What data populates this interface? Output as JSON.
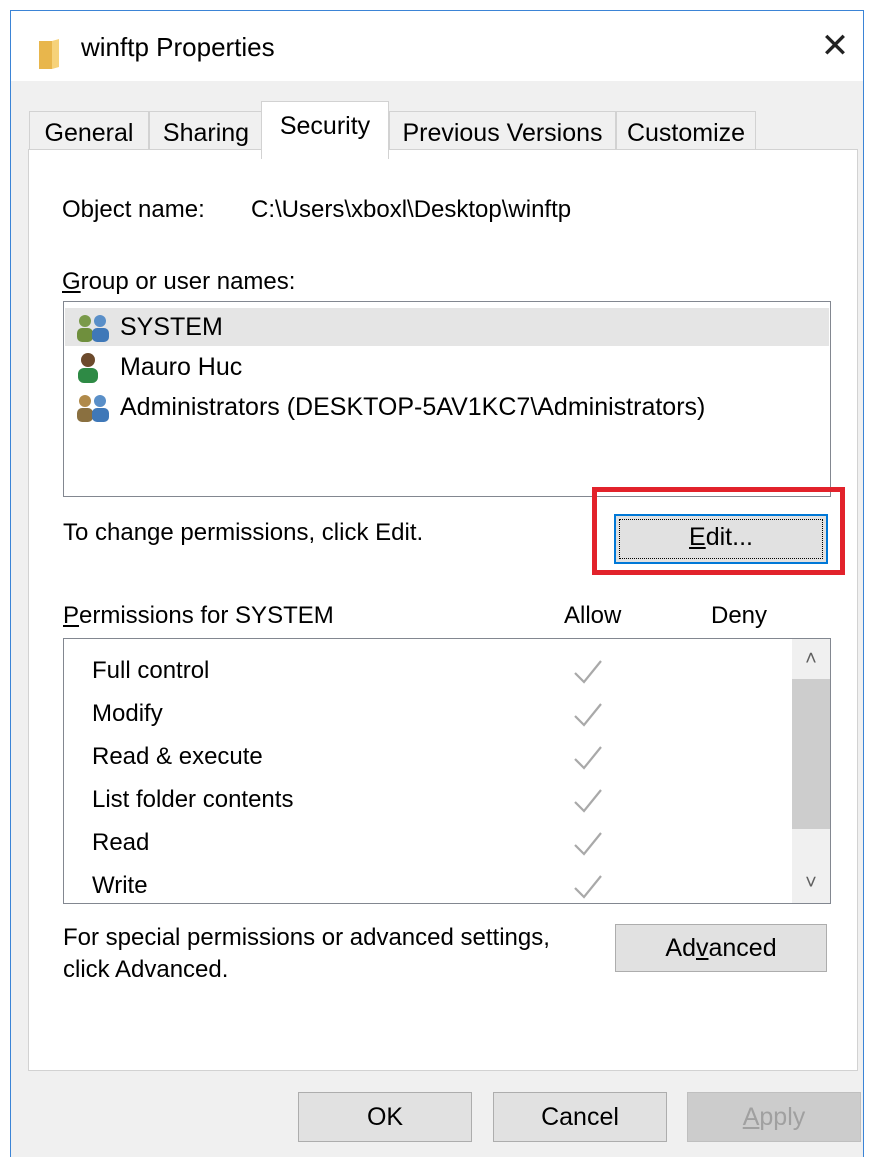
{
  "window": {
    "title": "winftp Properties",
    "close_glyph": "✕"
  },
  "tabs": [
    {
      "label": "General",
      "active": false
    },
    {
      "label": "Sharing",
      "active": false
    },
    {
      "label": "Security",
      "active": true
    },
    {
      "label": "Previous Versions",
      "active": false
    },
    {
      "label": "Customize",
      "active": false
    }
  ],
  "security": {
    "object_name_label": "Object name:",
    "object_name_value": "C:\\Users\\xboxl\\Desktop\\winftp",
    "group_label_accel": "G",
    "group_label_rest": "roup or user names:",
    "users": [
      {
        "name": "SYSTEM",
        "icon": "users-group-icon",
        "selected": true
      },
      {
        "name": "Mauro Huc",
        "icon": "user-icon",
        "selected": false
      },
      {
        "name": "Administrators (DESKTOP-5AV1KC7\\Administrators)",
        "icon": "users-group-icon",
        "selected": false
      }
    ],
    "change_text": "To change permissions, click Edit.",
    "edit_button_accel": "E",
    "edit_button_rest": "dit...",
    "permissions_label_accel": "P",
    "permissions_label_rest": "ermissions for SYSTEM",
    "allow_header": "Allow",
    "deny_header": "Deny",
    "permissions": [
      {
        "name": "Full control",
        "allow": true,
        "deny": false
      },
      {
        "name": "Modify",
        "allow": true,
        "deny": false
      },
      {
        "name": "Read & execute",
        "allow": true,
        "deny": false
      },
      {
        "name": "List folder contents",
        "allow": true,
        "deny": false
      },
      {
        "name": "Read",
        "allow": true,
        "deny": false
      },
      {
        "name": "Write",
        "allow": true,
        "deny": false
      }
    ],
    "advanced_text_line1": "For special permissions or advanced settings,",
    "advanced_text_line2": "click Advanced.",
    "advanced_button_pre": "Ad",
    "advanced_button_accel": "v",
    "advanced_button_post": "anced"
  },
  "footer": {
    "ok_label": "OK",
    "cancel_label": "Cancel",
    "apply_accel": "A",
    "apply_rest": "pply"
  },
  "colors": {
    "highlight": "#e2222b",
    "focus": "#0078d7",
    "window_border": "#3b84d6"
  }
}
